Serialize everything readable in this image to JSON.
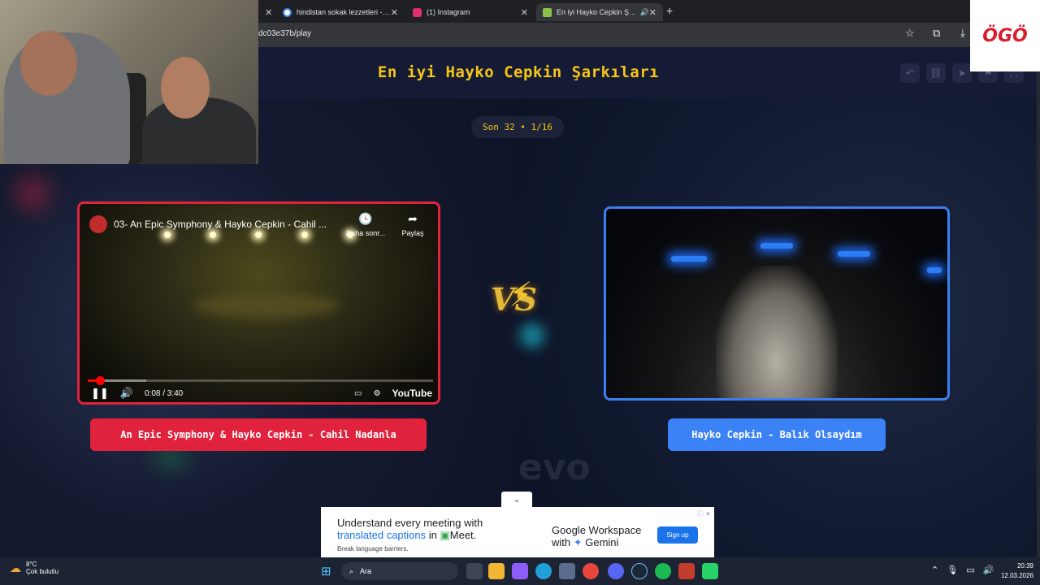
{
  "browser": {
    "tabs": [
      {
        "label": "hindistan sokak lezzetleri - Goo",
        "favicon_color": "#4285f4"
      },
      {
        "label": "(1) Instagram",
        "favicon_color": "#e1306c"
      },
      {
        "label": "En iyi Hayko Cepkin Şarkıla",
        "favicon_color": "#8bc34a",
        "active": true
      }
    ],
    "url": "dc03e37b/play"
  },
  "page": {
    "title": "En iyi Hayko Cepkin Şarkıları",
    "round_badge": "Son 32 • 1/16",
    "vs_label": "VS",
    "left": {
      "button_label": "An Epic Symphony & Hayko Cepkin - Cahil Nadanla",
      "video": {
        "title": "03- An Epic Symphony & Hayko Cepkin - Cahil ...",
        "watch_later": "Daha sonr...",
        "share": "Paylaş",
        "time": "0:08 / 3:40",
        "progress": 0.036,
        "logo": "YouTube"
      },
      "accent": "#e2233d"
    },
    "right": {
      "button_label": "Hayko Cepkin - Balık Olsaydım",
      "accent": "#3d7ff0"
    }
  },
  "ad": {
    "headline1": "Understand every meeting with",
    "headline2_link": "translated captions",
    "headline2_rest": " in ",
    "meet": "Meet.",
    "subtext": "Break language barriers.",
    "brand1": "Google Workspace",
    "brand2_prefix": "with ",
    "brand2_gemini": "Gemini",
    "cta": "Sign up"
  },
  "overlay": {
    "logo_text": "ÖGÖ"
  },
  "taskbar": {
    "weather_temp": "8°C",
    "weather_desc": "Çok bulutlu",
    "search_placeholder": "Ara",
    "time": "20:39",
    "date": "12.03.2026"
  }
}
